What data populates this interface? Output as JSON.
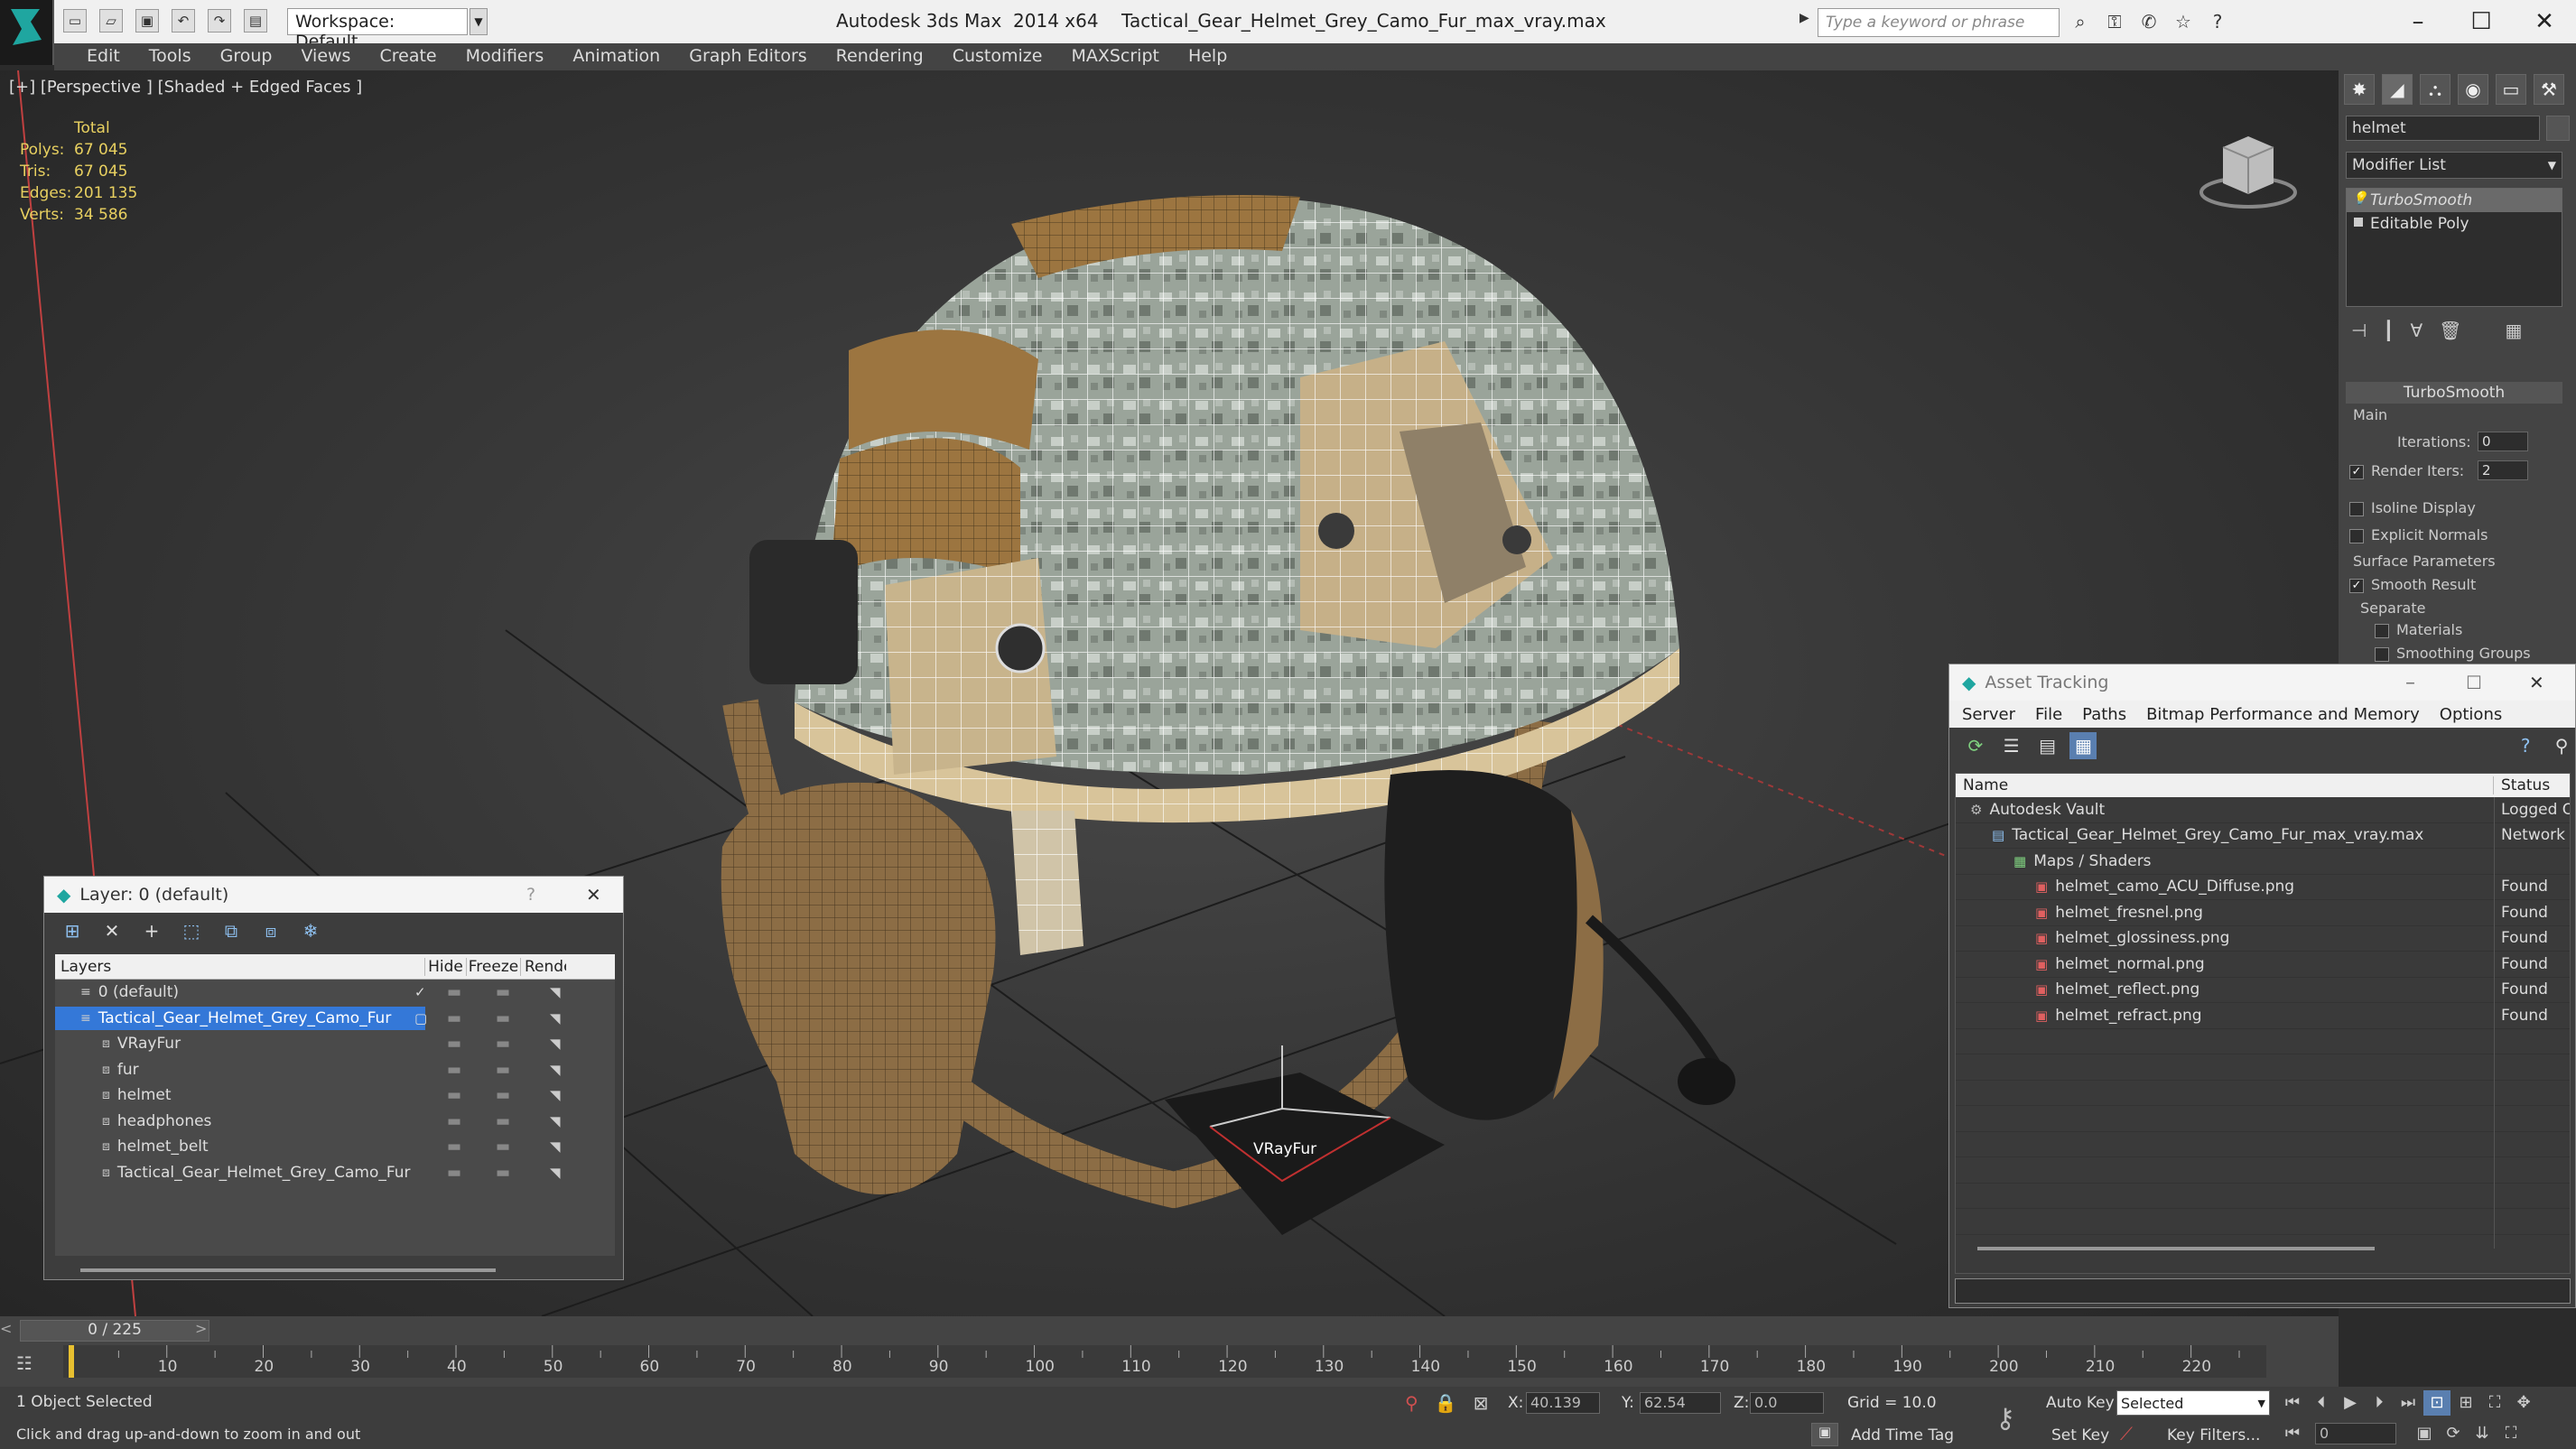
{
  "titlebar": {
    "workspace": "Workspace: Default",
    "app": "Autodesk 3ds Max  2014 x64",
    "file": "Tactical_Gear_Helmet_Grey_Camo_Fur_max_vray.max",
    "search_placeholder": "Type a keyword or phrase"
  },
  "menus": [
    "Edit",
    "Tools",
    "Group",
    "Views",
    "Create",
    "Modifiers",
    "Animation",
    "Graph Editors",
    "Rendering",
    "Customize",
    "MAXScript",
    "Help"
  ],
  "viewport": {
    "label": "[+] [Perspective ] [Shaded + Edged Faces ]",
    "stats_header": "Total",
    "stats": [
      {
        "k": "Polys:",
        "v": "67 045"
      },
      {
        "k": "Tris:",
        "v": "67 045"
      },
      {
        "k": "Edges:",
        "v": "201 135"
      },
      {
        "k": "Verts:",
        "v": "34 586"
      }
    ],
    "gizmo_label": "VRayFur"
  },
  "command_panel": {
    "object_name": "helmet",
    "modifier_list": "Modifier List",
    "stack": [
      "TurboSmooth",
      "Editable Poly"
    ],
    "rollout": "TurboSmooth",
    "main": "Main",
    "iterations_label": "Iterations:",
    "iterations": "0",
    "render_iters_label": "Render Iters:",
    "render_iters": "2",
    "isoline": "Isoline Display",
    "explicit": "Explicit Normals",
    "surface": "Surface Parameters",
    "smooth": "Smooth Result",
    "separate": "Separate",
    "materials": "Materials",
    "smoothing": "Smoothing Groups"
  },
  "layer_dialog": {
    "title": "Layer: 0 (default)",
    "help": "?",
    "cols": [
      "Layers",
      "Hide",
      "Freeze",
      "Rende"
    ],
    "rows": [
      {
        "name": "0 (default)",
        "indent": 1,
        "sel": false,
        "active": true
      },
      {
        "name": "Tactical_Gear_Helmet_Grey_Camo_Fur",
        "indent": 1,
        "sel": true,
        "active": false
      },
      {
        "name": "VRayFur",
        "indent": 2,
        "sel": false,
        "active": false
      },
      {
        "name": "fur",
        "indent": 2,
        "sel": false,
        "active": false
      },
      {
        "name": "helmet",
        "indent": 2,
        "sel": false,
        "active": false
      },
      {
        "name": "headphones",
        "indent": 2,
        "sel": false,
        "active": false
      },
      {
        "name": "helmet_belt",
        "indent": 2,
        "sel": false,
        "active": false
      },
      {
        "name": "Tactical_Gear_Helmet_Grey_Camo_Fur",
        "indent": 2,
        "sel": false,
        "active": false
      }
    ]
  },
  "asset_dialog": {
    "title": "Asset Tracking",
    "menus": [
      "Server",
      "File",
      "Paths",
      "Bitmap Performance and Memory",
      "Options"
    ],
    "cols": [
      "Name",
      "Status"
    ],
    "rows": [
      {
        "name": "Autodesk Vault",
        "status": "Logged O",
        "indent": 1
      },
      {
        "name": "Tactical_Gear_Helmet_Grey_Camo_Fur_max_vray.max",
        "status": "Network P",
        "indent": 2
      },
      {
        "name": "Maps / Shaders",
        "status": "",
        "indent": 3
      },
      {
        "name": "helmet_camo_ACU_Diffuse.png",
        "status": "Found",
        "indent": 4
      },
      {
        "name": "helmet_fresnel.png",
        "status": "Found",
        "indent": 4
      },
      {
        "name": "helmet_glossiness.png",
        "status": "Found",
        "indent": 4
      },
      {
        "name": "helmet_normal.png",
        "status": "Found",
        "indent": 4
      },
      {
        "name": "helmet_reflect.png",
        "status": "Found",
        "indent": 4
      },
      {
        "name": "helmet_refract.png",
        "status": "Found",
        "indent": 4
      }
    ]
  },
  "timeline": {
    "frame": "0 / 225",
    "ticks": [
      "0",
      "10",
      "20",
      "30",
      "40",
      "50",
      "60",
      "70",
      "80",
      "90",
      "100",
      "110",
      "120",
      "130",
      "140",
      "150",
      "160",
      "170",
      "180",
      "190",
      "200",
      "210",
      "220"
    ]
  },
  "status": {
    "selected": "1 Object Selected",
    "hint": "Click and drag up-and-down to zoom in and out",
    "x_label": "X:",
    "x": "40.139",
    "y_label": "Y:",
    "y": "62.54",
    "z_label": "Z:",
    "z": "0.0",
    "grid": "Grid = 10.0",
    "auto_key": "Auto Key",
    "set_key": "Set Key",
    "selected_mode": "Selected",
    "key_filters": "Key Filters...",
    "add_time_tag": "Add Time Tag",
    "frame": "0"
  }
}
